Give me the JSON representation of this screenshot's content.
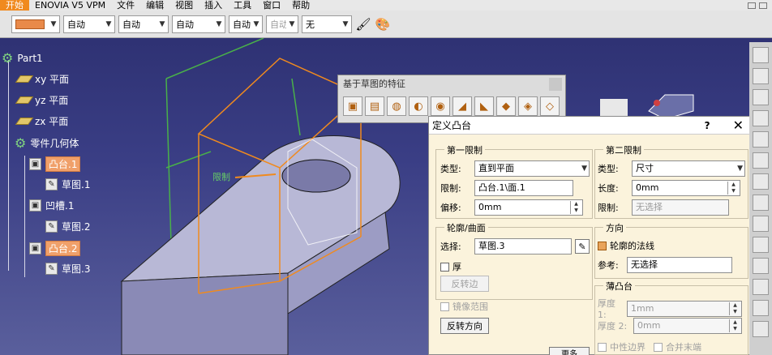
{
  "menu": {
    "items": [
      "开始",
      "ENOVIA V5 VPM",
      "文件",
      "编辑",
      "视图",
      "插入",
      "工具",
      "窗口",
      "帮助"
    ],
    "active_index": 0
  },
  "toolbar": {
    "color_swatch": "#e98a4a",
    "combos": [
      "自动",
      "自动",
      "自动",
      "自动",
      "自动",
      "无"
    ]
  },
  "tree": {
    "root": "Part1",
    "xy": "xy 平面",
    "yz": "yz 平面",
    "zx": "zx 平面",
    "body": "零件几何体",
    "pad1": "凸台.1",
    "sketch1": "草图.1",
    "pocket1": "凹槽.1",
    "sketch2": "草图.2",
    "pad2": "凸台.2",
    "sketch3": "草图.3"
  },
  "floating_toolbar": {
    "title": "基于草图的特征"
  },
  "viewport": {
    "limit_label": "限制"
  },
  "dialog": {
    "title": "定义凸台",
    "help": "?",
    "close": "✕",
    "first_limit": {
      "label": "第一限制",
      "type_label": "类型:",
      "type_value": "直到平面",
      "limit_label": "限制:",
      "limit_value": "凸台.1\\面.1",
      "offset_label": "偏移:",
      "offset_value": "0mm"
    },
    "second_limit": {
      "label": "第二限制",
      "type_label": "类型:",
      "type_value": "尺寸",
      "length_label": "长度:",
      "length_value": "0mm",
      "limit_label": "限制:",
      "limit_value": "无选择"
    },
    "profile": {
      "label": "轮廓/曲面",
      "select_label": "选择:",
      "select_value": "草图.3",
      "thick_label": "厚",
      "reverse_side": "反转边"
    },
    "direction": {
      "label": "方向",
      "normal_label": "轮廓的法线",
      "normal_checked": true,
      "reference_label": "参考:",
      "reference_value": "无选择"
    },
    "thin_pad": {
      "label": "薄凸台",
      "thickness1_label": "厚度 1:",
      "thickness1_value": "1mm",
      "thickness2_label": "厚度 2:",
      "thickness2_value": "0mm",
      "neutral_fiber": "中性边界",
      "merge_ends": "合并末端"
    },
    "mirrored_extent": "镜像范围",
    "reverse_direction": "反转方向",
    "more": "更多"
  }
}
